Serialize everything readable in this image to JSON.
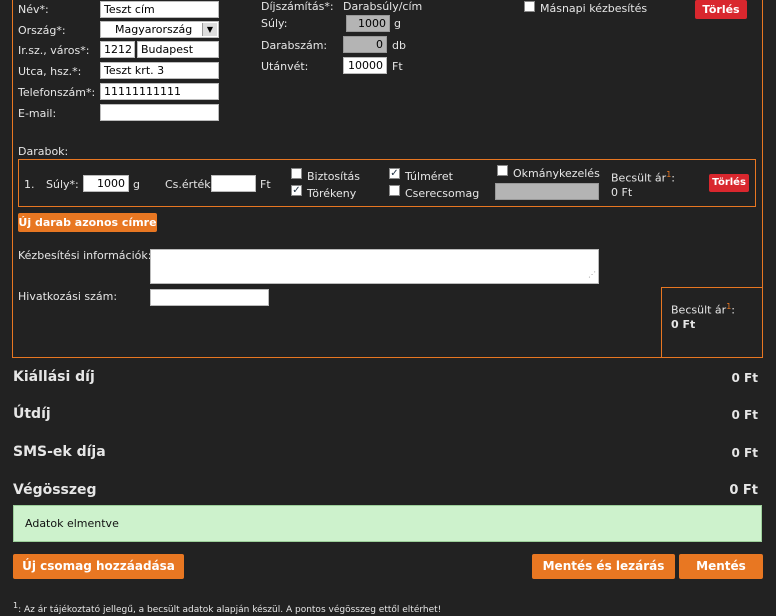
{
  "address": {
    "name_label": "Név*:",
    "name_value": "Teszt cím",
    "country_label": "Ország*:",
    "country_value": "Magyarország",
    "zip_city_label": "Ir.sz., város*:",
    "zip_value": "1212",
    "city_value": "Budapest",
    "street_label": "Utca, hsz.*:",
    "street_value": "Teszt krt. 3",
    "phone_label": "Telefonszám*:",
    "phone_value": "11111111111",
    "email_label": "E-mail:",
    "email_value": ""
  },
  "pricing": {
    "calc_label": "Díjszámítás*:",
    "calc_value": "Darabsúly/cím",
    "weight_label": "Súly:",
    "weight_value": "1000",
    "weight_unit": "g",
    "count_label": "Darabszám:",
    "count_value": "0",
    "count_unit": "db",
    "cod_label": "Utánvét:",
    "cod_value": "10000",
    "cod_unit": "Ft",
    "next_day_label": "Másnapi kézbesítés",
    "delete_label": "Törlés"
  },
  "pieces": {
    "title": "Darabok:",
    "row": {
      "index": "1.",
      "weight_label": "Súly*:",
      "weight_value": "1000",
      "weight_unit": "g",
      "value_label": "Cs.érték:",
      "value_value": "",
      "value_unit": "Ft",
      "insurance_label": "Biztosítás",
      "fragile_label": "Törékeny",
      "oversize_label": "Túlméret",
      "swap_label": "Cserecsomag",
      "document_label": "Okmánykezelés",
      "est_label": "Becsült ár",
      "est_sup": "1",
      "est_colon": ":",
      "est_value": "0 Ft",
      "delete_label": "Törlés"
    },
    "add_button": "Új darab azonos címre"
  },
  "delivery": {
    "info_label": "Kézbesítési információk:",
    "ref_label": "Hivatkozási szám:",
    "est_label": "Becsült ár",
    "est_sup": "1",
    "est_colon": ":",
    "est_value": "0 Ft"
  },
  "summary": [
    {
      "label": "Kiállási díj",
      "value": "0 Ft"
    },
    {
      "label": "Útdíj",
      "value": "0 Ft"
    },
    {
      "label": "SMS-ek díja",
      "value": "0 Ft"
    },
    {
      "label": "Végösszeg",
      "value": "0 Ft"
    }
  ],
  "status_message": "Adatok elmentve",
  "buttons": {
    "add_package": "Új csomag hozzáadása",
    "save_close": "Mentés és lezárás",
    "save": "Mentés"
  },
  "footnote_sup": "1",
  "footnote": ": Az ár tájékoztató jellegű, a becsült adatok alapján készül. A pontos végösszeg ettől eltérhet!",
  "colors": {
    "accent": "#e87722",
    "danger": "#d9272e",
    "success_bg": "#cdf2cc",
    "bg": "#222222"
  }
}
